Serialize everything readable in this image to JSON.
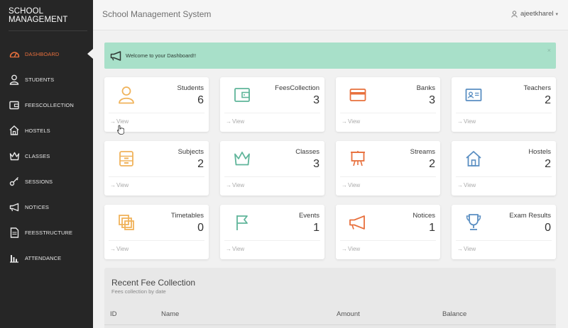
{
  "sidebar": {
    "brand": "SCHOOL MANAGEMENT",
    "items": [
      {
        "label": "DASHBOARD",
        "icon": "dashboard-icon",
        "active": true
      },
      {
        "label": "STUDENTS",
        "icon": "user-icon"
      },
      {
        "label": "FEESCOLLECTION",
        "icon": "wallet-icon"
      },
      {
        "label": "HOSTELS",
        "icon": "home-icon"
      },
      {
        "label": "CLASSES",
        "icon": "crown-icon"
      },
      {
        "label": "SESSIONS",
        "icon": "key-icon"
      },
      {
        "label": "NOTICES",
        "icon": "megaphone-icon"
      },
      {
        "label": "FEESSTRUCTURE",
        "icon": "document-icon"
      },
      {
        "label": "ATTENDANCE",
        "icon": "bar-chart-icon"
      }
    ]
  },
  "header": {
    "title": "School Management System",
    "user": "ajeetkharel"
  },
  "alert": {
    "text": "Welcome to your Dashboard!!",
    "close": "×"
  },
  "cards": [
    {
      "label": "Students",
      "count": "6",
      "icon": "user-icon",
      "color": "#f0b35b"
    },
    {
      "label": "FeesCollection",
      "count": "3",
      "icon": "wallet-icon",
      "color": "#5fb59a"
    },
    {
      "label": "Banks",
      "count": "3",
      "icon": "credit-card-icon",
      "color": "#e8703d"
    },
    {
      "label": "Teachers",
      "count": "2",
      "icon": "id-card-icon",
      "color": "#5a8ec2"
    },
    {
      "label": "Subjects",
      "count": "2",
      "icon": "cabinet-icon",
      "color": "#f0b35b"
    },
    {
      "label": "Classes",
      "count": "3",
      "icon": "crown-icon",
      "color": "#5fb59a"
    },
    {
      "label": "Streams",
      "count": "2",
      "icon": "presentation-icon",
      "color": "#e8703d"
    },
    {
      "label": "Hostels",
      "count": "2",
      "icon": "home-icon",
      "color": "#5a8ec2"
    },
    {
      "label": "Timetables",
      "count": "0",
      "icon": "layers-icon",
      "color": "#f0b35b"
    },
    {
      "label": "Events",
      "count": "1",
      "icon": "flag-icon",
      "color": "#5fb59a"
    },
    {
      "label": "Notices",
      "count": "1",
      "icon": "megaphone-icon",
      "color": "#e8703d"
    },
    {
      "label": "Exam Results",
      "count": "0",
      "icon": "trophy-icon",
      "color": "#5a8ec2"
    }
  ],
  "view_label": "View",
  "recent": {
    "title": "Recent Fee Collection",
    "subtitle": "Fees collection by date",
    "columns": [
      "ID",
      "Name",
      "Amount",
      "Balance"
    ]
  },
  "colors": {
    "accent": "#e8703d",
    "alert_bg": "#a8e0c9",
    "sidebar_bg": "#262626"
  }
}
